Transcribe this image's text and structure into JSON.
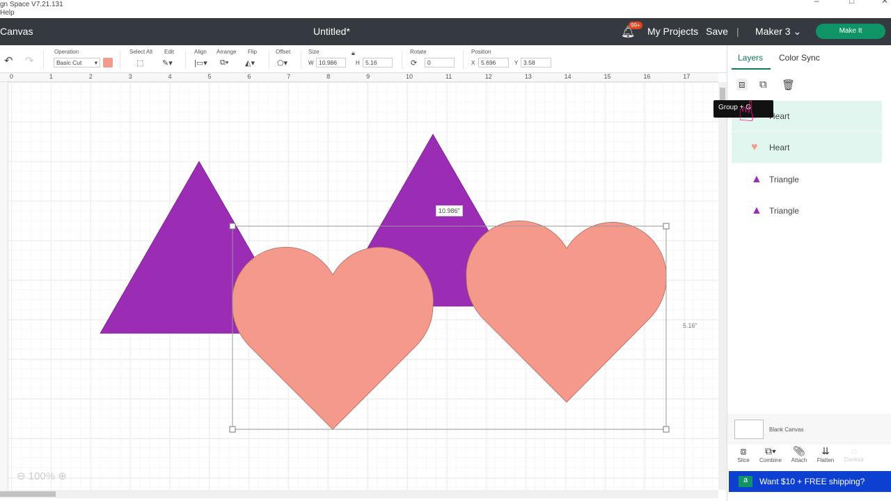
{
  "window": {
    "title": "gn Space  V7.21.131",
    "menu": "Help"
  },
  "topbar": {
    "title": "Canvas",
    "document": "Untitled*",
    "notifications": "99+",
    "my_projects": "My Projects",
    "save": "Save",
    "separator": "|",
    "machine": "Maker 3",
    "make_it": "Make It"
  },
  "toolbar": {
    "operation_label": "Operation",
    "operation_value": "Basic Cut",
    "operation_color": "#f4998c",
    "select_all": "Select All",
    "edit": "Edit",
    "align": "Align",
    "arrange": "Arrange",
    "flip": "Flip",
    "offset": "Offset",
    "size": "Size",
    "w_label": "W",
    "w_value": "10.986",
    "h_label": "H",
    "h_value": "5.16",
    "rotate": "Rotate",
    "rotate_value": "0",
    "position": "Position",
    "x_label": "X",
    "x_value": "5.696",
    "y_label": "Y",
    "y_value": "3.58"
  },
  "ruler": [
    "0",
    "1",
    "2",
    "3",
    "4",
    "5",
    "6",
    "7",
    "8",
    "9",
    "10",
    "11",
    "12",
    "13",
    "14",
    "15",
    "16",
    "17"
  ],
  "canvas": {
    "width_tag": "10.986\"",
    "height_tag": "5.16\"",
    "zoom": "100%",
    "triangle_color": "#9b2db5",
    "heart_color": "#f4998c"
  },
  "panel": {
    "tabs": [
      "Layers",
      "Color Sync"
    ],
    "tooltip": "Group      + G",
    "layers": [
      {
        "name": "Heart",
        "icon": "heart"
      },
      {
        "name": "Heart",
        "icon": "heart"
      },
      {
        "name": "Triangle",
        "icon": "triangle"
      },
      {
        "name": "Triangle",
        "icon": "triangle"
      }
    ],
    "blank_canvas": "Blank Canvas",
    "tools": [
      "Slice",
      "Combine",
      "Attach",
      "Flatten",
      "Contour"
    ],
    "ad": "Want $10 + FREE shipping?",
    "ad_logo": "a"
  }
}
